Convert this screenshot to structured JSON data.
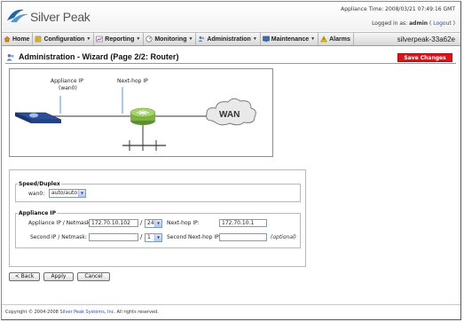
{
  "brand": {
    "name": "Silver Peak"
  },
  "header": {
    "appliance_time": "Appliance Time: 2008/03/21 07:49:16 GMT",
    "logged_in_prefix": "Logged in as: ",
    "user": "admin",
    "logout_prefix": " ( ",
    "logout_label": "Logout",
    "logout_suffix": " )",
    "hostname": "silverpeak-33a62e"
  },
  "menu": [
    {
      "label": "Home",
      "icon": "home-icon",
      "caret": false
    },
    {
      "label": "Configuration",
      "icon": "configuration-icon",
      "caret": true
    },
    {
      "label": "Reporting",
      "icon": "reporting-icon",
      "caret": true
    },
    {
      "label": "Monitoring",
      "icon": "monitoring-icon",
      "caret": true
    },
    {
      "label": "Administration",
      "icon": "administration-icon",
      "caret": true
    },
    {
      "label": "Maintenance",
      "icon": "maintenance-icon",
      "caret": true
    },
    {
      "label": "Alarms",
      "icon": "alarms-icon",
      "caret": false
    }
  ],
  "page": {
    "title": "Administration - Wizard (Page 2/2: Router)",
    "save_changes": "Save Changes"
  },
  "diagram": {
    "appliance_ip_label": "Appliance IP",
    "appliance_ip_sublabel": "(wan0)",
    "next_hop_label": "Next-hop IP",
    "wan_label": "WAN"
  },
  "speed_duplex": {
    "legend": "Speed/Duplex",
    "wan0_label": "wan0:",
    "wan0_value": "auto/auto"
  },
  "appliance_ip": {
    "legend": "Appliance IP",
    "ip_netmask_label": "Appliance IP / Netmask:",
    "ip_value": "172.70.10.102",
    "netmask_value": "24",
    "next_hop_label": "Next-hop IP:",
    "next_hop_value": "172.70.10.1",
    "second_ip_label": "Second IP / Netmask:",
    "second_ip_value": "",
    "second_netmask_value": "1",
    "second_next_hop_label": "Second Next-hop IP:",
    "second_next_hop_value": "",
    "optional_text": "(optional)",
    "slash": "/"
  },
  "buttons": {
    "back": "< Back",
    "apply": "Apply",
    "cancel": "Cancel"
  },
  "footer": {
    "prefix": "Copyright © 2004-2008 ",
    "company": "Silver Peak Systems, Inc.",
    "suffix": " All rights reserved."
  },
  "colors": {
    "accent": "#d9141b",
    "link": "#2a4f9c",
    "menubar": "#d8d8d8"
  }
}
